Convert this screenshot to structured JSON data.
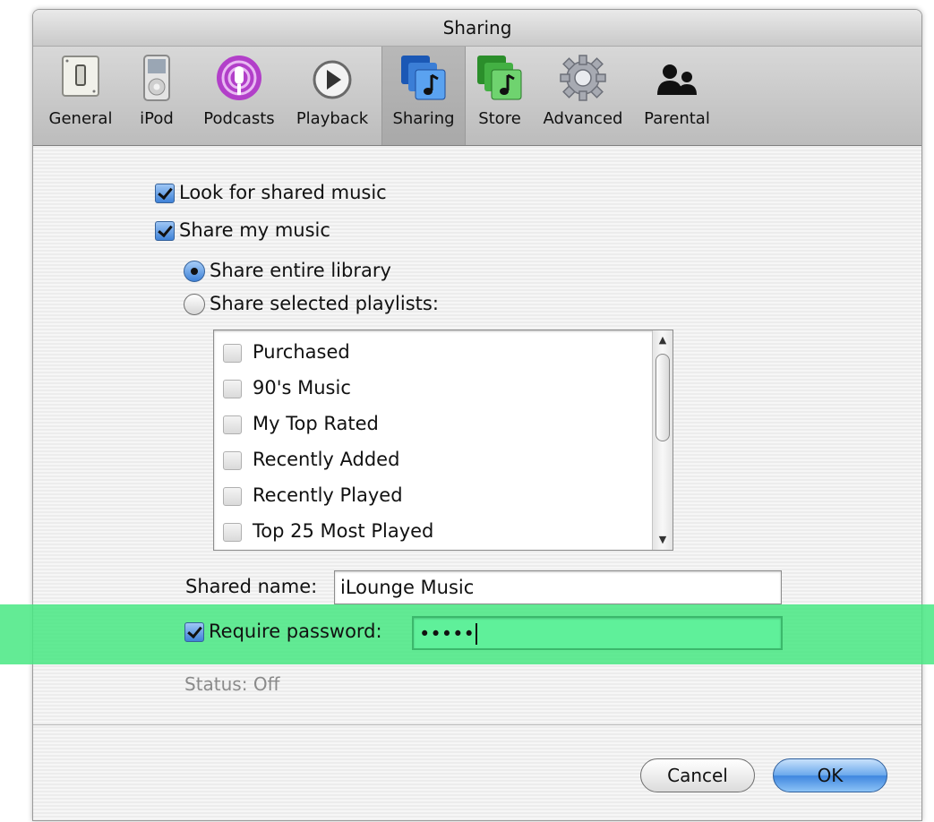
{
  "window": {
    "title": "Sharing"
  },
  "toolbar": {
    "tabs": [
      {
        "label": "General",
        "icon": "light-switch-icon"
      },
      {
        "label": "iPod",
        "icon": "ipod-icon"
      },
      {
        "label": "Podcasts",
        "icon": "podcast-microphone-icon"
      },
      {
        "label": "Playback",
        "icon": "play-button-icon"
      },
      {
        "label": "Sharing",
        "icon": "shared-music-icon",
        "selected": true
      },
      {
        "label": "Store",
        "icon": "store-music-icon"
      },
      {
        "label": "Advanced",
        "icon": "gear-icon"
      },
      {
        "label": "Parental",
        "icon": "parental-silhouette-icon"
      }
    ]
  },
  "options": {
    "look_for_shared": {
      "label": "Look for shared music",
      "checked": true
    },
    "share_my_music": {
      "label": "Share my music",
      "checked": true
    },
    "share_entire": {
      "label": "Share entire library",
      "selected": true
    },
    "share_selected": {
      "label": "Share selected playlists:",
      "selected": false
    }
  },
  "playlists": [
    {
      "label": "Purchased",
      "checked": false
    },
    {
      "label": "90's Music",
      "checked": false
    },
    {
      "label": "My Top Rated",
      "checked": false
    },
    {
      "label": "Recently Added",
      "checked": false
    },
    {
      "label": "Recently Played",
      "checked": false
    },
    {
      "label": "Top 25 Most Played",
      "checked": false
    }
  ],
  "shared_name": {
    "label": "Shared name:",
    "value": "iLounge Music"
  },
  "password": {
    "label": "Require password:",
    "checked": true,
    "value": "•••••"
  },
  "status": {
    "text": "Status: Off"
  },
  "buttons": {
    "cancel": "Cancel",
    "ok": "OK"
  },
  "colors": {
    "highlight": "#48e882",
    "accent_blue": "#3f82d8"
  }
}
